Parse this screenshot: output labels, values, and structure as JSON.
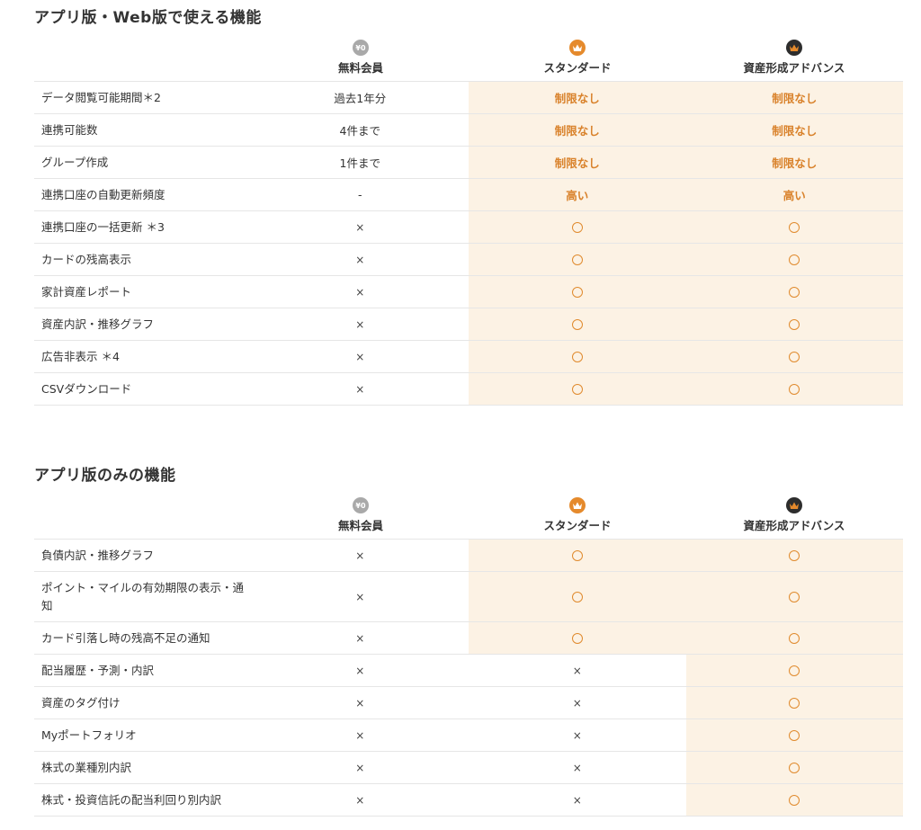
{
  "colors": {
    "accent": "#d9822b",
    "highlight": "#fcf2e4",
    "icon_free": "#a9a9a9",
    "icon_standard": "#e58a2c",
    "icon_advance": "#2d2d2d"
  },
  "plans": {
    "free_label": "無料会員",
    "free_badge": "¥0",
    "standard_label": "スタンダード",
    "advance_label": "資産形成アドバンス"
  },
  "sections": [
    {
      "title": "アプリ版・Web版で使える機能",
      "rows": [
        {
          "feature": "データ閲覧可能期間＊2",
          "free": "過去1年分",
          "standard": "制限なし",
          "advance": "制限なし"
        },
        {
          "feature": "連携可能数",
          "free": "4件まで",
          "standard": "制限なし",
          "advance": "制限なし"
        },
        {
          "feature": "グループ作成",
          "free": "1件まで",
          "standard": "制限なし",
          "advance": "制限なし"
        },
        {
          "feature": "連携口座の自動更新頻度",
          "free": "-",
          "standard": "高い",
          "advance": "高い"
        },
        {
          "feature": "連携口座の一括更新 ＊3",
          "free": "×",
          "standard": "○",
          "advance": "○"
        },
        {
          "feature": "カードの残高表示",
          "free": "×",
          "standard": "○",
          "advance": "○"
        },
        {
          "feature": "家計資産レポート",
          "free": "×",
          "standard": "○",
          "advance": "○"
        },
        {
          "feature": "資産内訳・推移グラフ",
          "free": "×",
          "standard": "○",
          "advance": "○"
        },
        {
          "feature": "広告非表示 ＊4",
          "free": "×",
          "standard": "○",
          "advance": "○"
        },
        {
          "feature": "CSVダウンロード",
          "free": "×",
          "standard": "○",
          "advance": "○"
        }
      ]
    },
    {
      "title": "アプリ版のみの機能",
      "rows": [
        {
          "feature": "負債内訳・推移グラフ",
          "free": "×",
          "standard": "○",
          "advance": "○"
        },
        {
          "feature": "ポイント・マイルの有効期限の表示・通知",
          "free": "×",
          "standard": "○",
          "advance": "○"
        },
        {
          "feature": "カード引落し時の残高不足の通知",
          "free": "×",
          "standard": "○",
          "advance": "○"
        },
        {
          "feature": "配当履歴・予測・内訳",
          "free": "×",
          "standard": "×",
          "advance": "○"
        },
        {
          "feature": "資産のタグ付け",
          "free": "×",
          "standard": "×",
          "advance": "○"
        },
        {
          "feature": "Myポートフォリオ",
          "free": "×",
          "standard": "×",
          "advance": "○"
        },
        {
          "feature": "株式の業種別内訳",
          "free": "×",
          "standard": "×",
          "advance": "○"
        },
        {
          "feature": "株式・投資信託の配当利回り別内訳",
          "free": "×",
          "standard": "×",
          "advance": "○"
        }
      ]
    }
  ]
}
